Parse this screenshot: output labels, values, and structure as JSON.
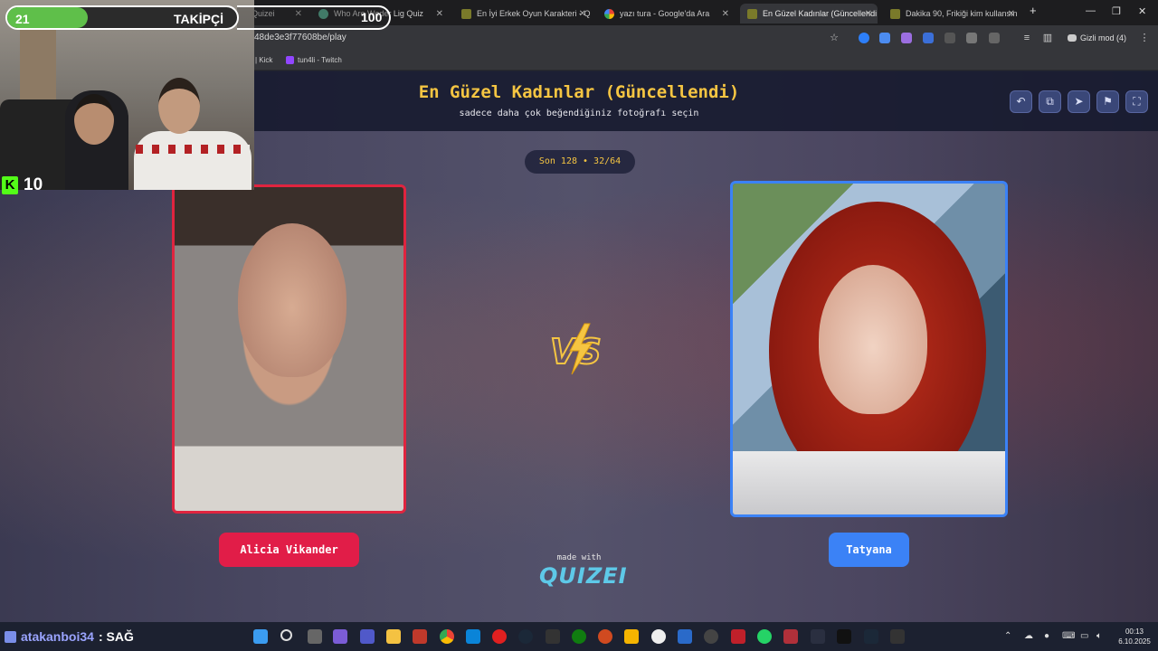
{
  "browser": {
    "tabs": [
      {
        "label": "Quizei"
      },
      {
        "label": "Who Are Weder Lig Quiz"
      },
      {
        "label": "En İyi Erkek Oyun Karakteri - Q"
      },
      {
        "label": "yazı tura - Google'da Ara"
      },
      {
        "label": "En Güzel Kadınlar (Güncellendi"
      },
      {
        "label": "Dakika 90, Frikiği kim kullansın"
      }
    ],
    "new_tab": "+",
    "url": "48de3e3f77608be/play",
    "incognito": "Gizli mod (4)",
    "bookmarks": [
      {
        "label": "| Kick"
      },
      {
        "label": "tun4li - Twitch"
      }
    ]
  },
  "quiz": {
    "title": "En Güzel Kadınlar (Güncellendi)",
    "subtitle": "sadece daha çok beğendiğiniz fotoğrafı seçin",
    "round": "Son 128 • 32/64",
    "left_name": "Alicia Vikander",
    "right_name": "Tatyana",
    "made_with": "made with",
    "brand": "QUIZEI"
  },
  "overlay": {
    "followers_count": "21",
    "followers_label": "TAKİPÇİ",
    "followers_goal": "100",
    "followers_progress": 0.21,
    "kick_viewers": "10"
  },
  "taskbar": {
    "chat_user": "atakanboi34",
    "chat_message": ": SAĞ",
    "time": "00:13",
    "date": "6.10.2025"
  },
  "colors": {
    "title": "#f5c542",
    "left_accent": "#e11d48",
    "right_accent": "#3b82f6",
    "brand": "#5ec9e8",
    "kick_green": "#53fc18"
  }
}
